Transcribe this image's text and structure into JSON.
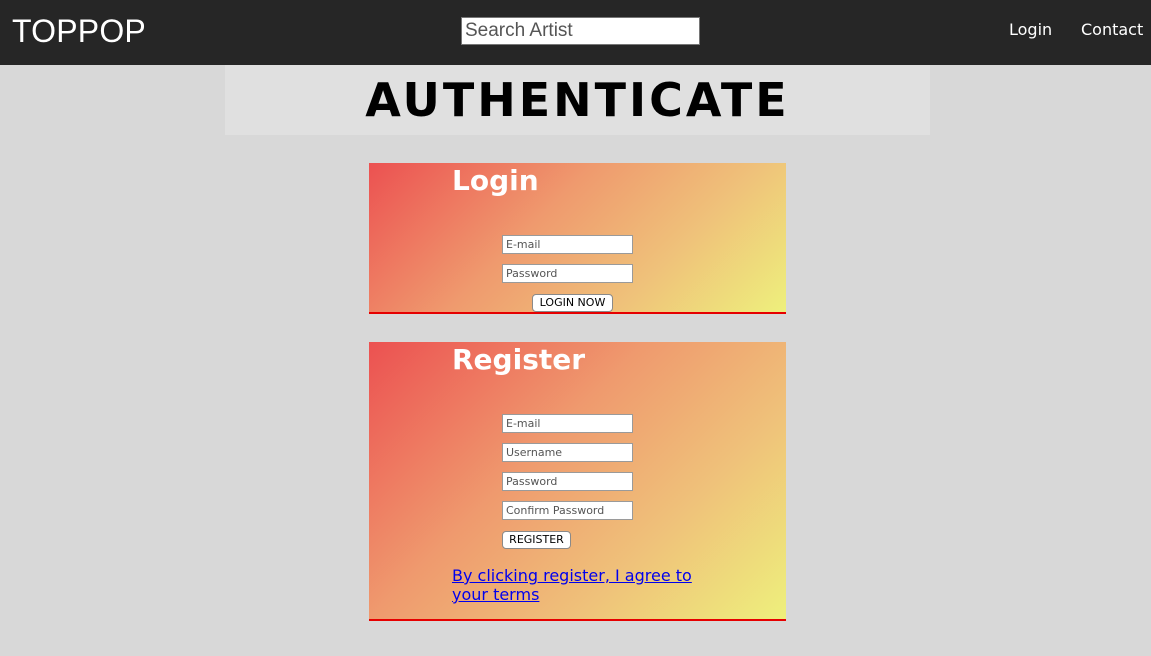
{
  "header": {
    "brand": "TOPPOP",
    "search_placeholder": "Search Artist",
    "nav": {
      "login": "Login",
      "contact": "Contact"
    }
  },
  "hero": {
    "title": "AUTHENTICATE"
  },
  "login_card": {
    "title": "Login",
    "email_placeholder": "E-mail",
    "password_placeholder": "Password",
    "button_label": "LOGIN NOW"
  },
  "register_card": {
    "title": "Register",
    "email_placeholder": "E-mail",
    "username_placeholder": "Username",
    "password_placeholder": "Password",
    "confirm_password_placeholder": "Confirm Password",
    "button_label": "REGISTER",
    "terms_link": "By clicking register, I agree to your terms"
  },
  "colors": {
    "navbar": "#262626",
    "page_background": "#d8d8d8",
    "hero_background": "#e0e0e0",
    "card_gradient_start": "#ec5151",
    "card_gradient_end": "#eef07c",
    "card_border": "#e60000",
    "link": "#0000ee"
  }
}
